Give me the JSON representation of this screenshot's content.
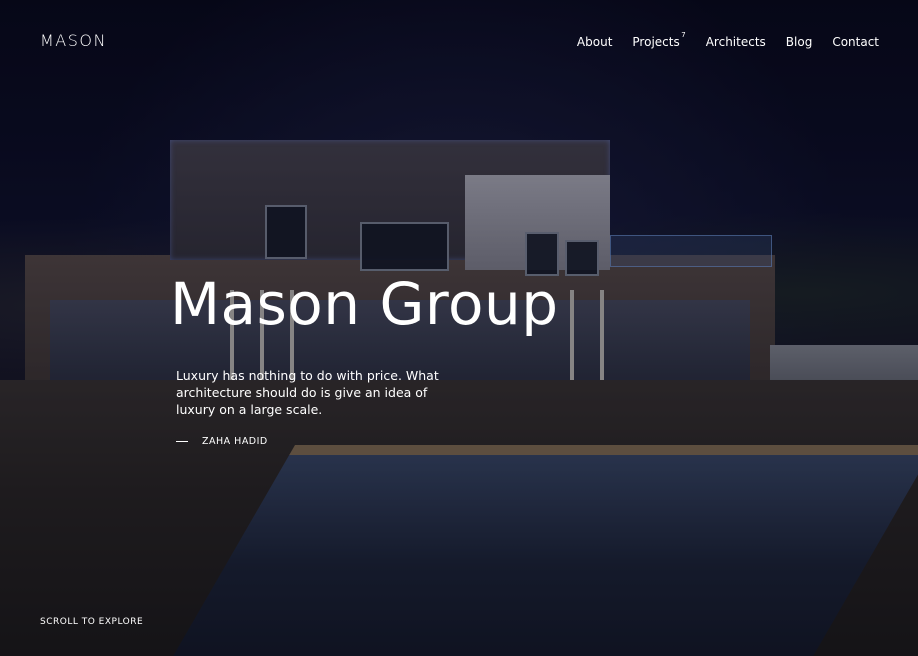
{
  "brand": {
    "logo": "MASON"
  },
  "nav": {
    "items": [
      {
        "label": "About"
      },
      {
        "label": "Projects",
        "badge": "7"
      },
      {
        "label": "Architects"
      },
      {
        "label": "Blog"
      },
      {
        "label": "Contact"
      }
    ]
  },
  "hero": {
    "title": "Mason Group",
    "quote": "Luxury has nothing to do with price. What architecture should do is give an idea of luxury on a large scale.",
    "author": "ZAHA HADID",
    "scroll_label": "SCROLL TO EXPLORE"
  }
}
